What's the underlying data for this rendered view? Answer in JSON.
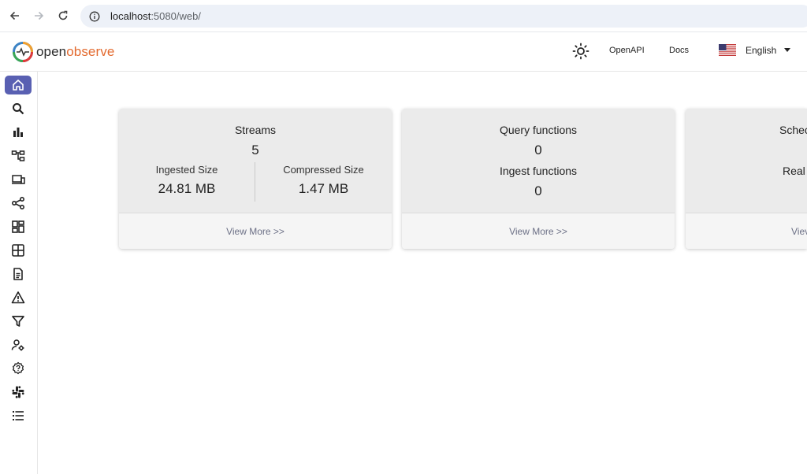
{
  "browser": {
    "url_host": "localhost",
    "url_path": ":5080/web/"
  },
  "header": {
    "logo_open": "open",
    "logo_observe": "observe",
    "openapi_label": "OpenAPI",
    "docs_label": "Docs",
    "language_label": "English"
  },
  "sidebar": {
    "items": [
      {
        "name": "home-icon",
        "active": true
      },
      {
        "name": "search-icon"
      },
      {
        "name": "metrics-icon"
      },
      {
        "name": "traces-icon"
      },
      {
        "name": "rum-icon"
      },
      {
        "name": "pipeline-icon"
      },
      {
        "name": "dashboards-icon"
      },
      {
        "name": "streams-icon"
      },
      {
        "name": "reports-icon"
      },
      {
        "name": "alerts-icon"
      },
      {
        "name": "functions-icon"
      },
      {
        "name": "iam-icon"
      },
      {
        "name": "help-icon"
      },
      {
        "name": "slack-icon"
      },
      {
        "name": "menu-list-icon"
      }
    ]
  },
  "cards": {
    "streams": {
      "title": "Streams",
      "count": "5",
      "ingested_label": "Ingested Size",
      "ingested_value": "24.81 MB",
      "compressed_label": "Compressed Size",
      "compressed_value": "1.47 MB",
      "view_more": "View More >>"
    },
    "functions": {
      "query_label": "Query functions",
      "query_value": "0",
      "ingest_label": "Ingest functions",
      "ingest_value": "0",
      "view_more": "View More >>"
    },
    "scheduled": {
      "title": "Schec",
      "realtime_label": "Real",
      "view_more": "Viev"
    }
  },
  "colors": {
    "accent": "#5960b2",
    "logo_orange": "#e36a2f"
  }
}
